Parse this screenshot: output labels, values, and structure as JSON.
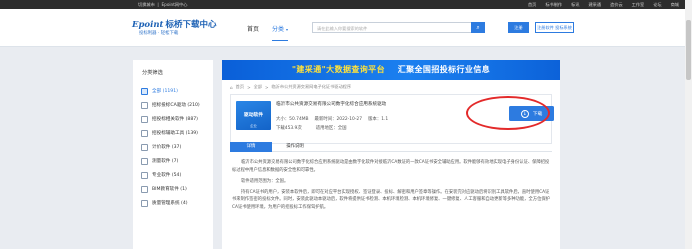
{
  "topbar": {
    "city": "切换城市",
    "site": "Epoint网中心",
    "links": [
      "首页",
      "标书制作",
      "标讯",
      "建采通",
      "造价云",
      "工作室",
      "论坛",
      "商城"
    ]
  },
  "header": {
    "logo_brand": "Epoint",
    "logo_cn": "标桥下载中心",
    "logo_sub": "投标利器 · 轻松下载",
    "nav_home": "首页",
    "nav_category": "分类",
    "search_placeholder": "请在此输入你要搜索的软件",
    "search_icon": "search-icon",
    "register_label": "注册",
    "login_label": "注册软件 投标系统"
  },
  "sidebar": {
    "title": "分类筛选",
    "items": [
      {
        "label": "全部 (1191)",
        "active": true
      },
      {
        "label": "招标投标CA驱动 (210)"
      },
      {
        "label": "招投标相关软件 (887)"
      },
      {
        "label": "招投标辅助工具 (139)"
      },
      {
        "label": "计价软件 (37)"
      },
      {
        "label": "测量软件 (7)"
      },
      {
        "label": "专业软件 (54)"
      },
      {
        "label": "BIM教育软件 (1)"
      },
      {
        "label": "质量管理系统 (4)"
      }
    ]
  },
  "banner": {
    "part1": "\"建采通\"大数据查询平台",
    "part2": "汇聚全国招投标行业信息"
  },
  "breadcrumb": [
    "首页",
    "全部",
    "临沂市公共资源交易网电子化证书驱动程序"
  ],
  "software": {
    "thumb_title": "驱动软件",
    "thumb_sub": "企业",
    "name": "临沂市公共资源交易有限公司数字化综合应用系统驱动",
    "size": "大小：50.74MB",
    "date": "最新时间：2022-10-27",
    "version": "版本：1.1",
    "downloads": "下载453.9次",
    "scope": "适用地区：全国",
    "download_label": "下载"
  },
  "tabs": [
    "详情",
    "操作说明"
  ],
  "description": [
    "临沂市公共资源交易有限公司数字化综合应用系统驱动是由数字化软件对接临沂CA数证的一款CA证书安全辅助应用。软件能够有效地实现电子身份认证、保障招投标过程中用户信息和数据的安全性和可靠性。",
    "软件适用范围为：全国。",
    "持有CA证书的用户，安装本软件后，即可在对应平台实现授权、签证登录、投标、解密和用户签章等操作。在安装完对应驱动后将识别工具软件后，直时使用CA证书来制作签密的投标文件。同时，安装此驱动本驱动后，软件将提供证书检测、本机环境检测、本机环境修复、一键修复、人工客服和自动更新等多种功能，全方位保护CA证书使用环境，为用户的招投标工作保驾护航。"
  ]
}
